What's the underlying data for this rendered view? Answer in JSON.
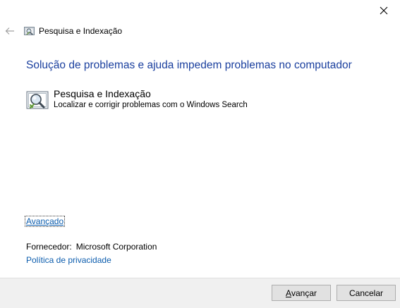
{
  "window": {
    "title": "Pesquisa e Indexação"
  },
  "icons": {
    "close": "close-icon",
    "back": "back-arrow-icon",
    "title": "troubleshooter-icon",
    "task": "magnifier-search-icon"
  },
  "main": {
    "heading": "Solução de problemas e ajuda impedem problemas no computador",
    "task": {
      "title": "Pesquisa e Indexação",
      "description": "Localizar e corrigir problemas com o Windows Search"
    },
    "advanced_link": "Avançado",
    "publisher": {
      "label": "Fornecedor:",
      "value": "Microsoft Corporation"
    },
    "privacy_link": "Política de privacidade"
  },
  "footer": {
    "next_label_prefix": "A",
    "next_label_rest": "vançar",
    "cancel_label": "Cancelar"
  },
  "colors": {
    "heading": "#1a3f9e",
    "link": "#0b5cad",
    "footer_bg": "#f0f0f0"
  }
}
